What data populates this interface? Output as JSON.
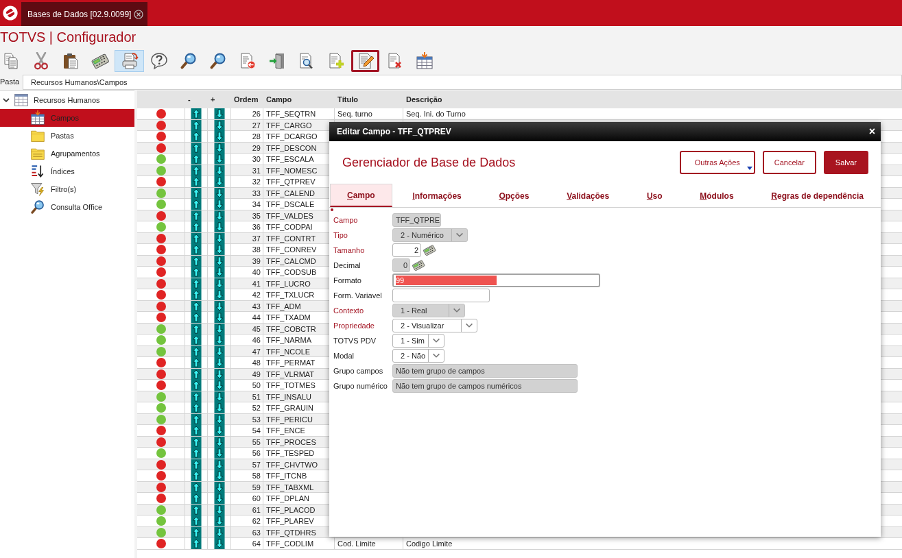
{
  "top_bar": {
    "tab": {
      "label": "Bases de Dados [02.9.0099]"
    }
  },
  "app_title": "TOTVS | Configurador",
  "toolbar": [
    {
      "hovered": false,
      "selected": false
    },
    {
      "hovered": false,
      "selected": false
    },
    {
      "hovered": false,
      "selected": false
    },
    {
      "hovered": false,
      "selected": false
    },
    {
      "hovered": true,
      "selected": false
    },
    {
      "hovered": false,
      "selected": false
    },
    {
      "hovered": false,
      "selected": false
    },
    {
      "hovered": false,
      "selected": false
    },
    {
      "hovered": false,
      "selected": false
    },
    {
      "hovered": false,
      "selected": false
    },
    {
      "hovered": false,
      "selected": false
    },
    {
      "hovered": false,
      "selected": false
    },
    {
      "hovered": false,
      "selected": true
    },
    {
      "hovered": false,
      "selected": false
    },
    {
      "hovered": false,
      "selected": false
    }
  ],
  "path": {
    "label": "Pasta",
    "value": "Recursos Humanos\\Campos"
  },
  "tree": [
    {
      "label": "Recursos Humanos",
      "expanded": true,
      "selected": false,
      "children": [
        {
          "label": "Campos",
          "selected": true
        },
        {
          "label": "Pastas",
          "selected": false
        },
        {
          "label": "Agrupamentos",
          "selected": false
        },
        {
          "label": "Índices",
          "selected": false
        },
        {
          "label": "Filtro(s)",
          "selected": false
        },
        {
          "label": "Consulta Office",
          "selected": false
        }
      ]
    }
  ],
  "table": {
    "columns": [
      "-",
      "+",
      "Ordem",
      "Campo",
      "Título",
      "Descrição"
    ],
    "rows": [
      {
        "color": "#e02424",
        "order": "26",
        "field": "TFF_SEQTRN",
        "title": "Seq. turno",
        "description": "Seq. Ini. do Turno"
      },
      {
        "color": "#e02424",
        "order": "27",
        "field": "TFF_CARGO"
      },
      {
        "color": "#e02424",
        "order": "28",
        "field": "TFF_DCARGO"
      },
      {
        "color": "#e02424",
        "order": "29",
        "field": "TFF_DESCON"
      },
      {
        "color": "#74c43e",
        "order": "30",
        "field": "TFF_ESCALA"
      },
      {
        "color": "#74c43e",
        "order": "31",
        "field": "TFF_NOMESC"
      },
      {
        "color": "#e02424",
        "order": "32",
        "field": "TFF_QTPREV"
      },
      {
        "color": "#74c43e",
        "order": "33",
        "field": "TFF_CALEND"
      },
      {
        "color": "#74c43e",
        "order": "34",
        "field": "TFF_DSCALE"
      },
      {
        "color": "#e02424",
        "order": "35",
        "field": "TFF_VALDES"
      },
      {
        "color": "#74c43e",
        "order": "36",
        "field": "TFF_CODPAI"
      },
      {
        "color": "#e02424",
        "order": "37",
        "field": "TFF_CONTRT"
      },
      {
        "color": "#e02424",
        "order": "38",
        "field": "TFF_CONREV"
      },
      {
        "color": "#e02424",
        "order": "39",
        "field": "TFF_CALCMD"
      },
      {
        "color": "#e02424",
        "order": "40",
        "field": "TFF_CODSUB"
      },
      {
        "color": "#e02424",
        "order": "41",
        "field": "TFF_LUCRO"
      },
      {
        "color": "#e02424",
        "order": "42",
        "field": "TFF_TXLUCR"
      },
      {
        "color": "#e02424",
        "order": "43",
        "field": "TFF_ADM"
      },
      {
        "color": "#e02424",
        "order": "44",
        "field": "TFF_TXADM"
      },
      {
        "color": "#74c43e",
        "order": "45",
        "field": "TFF_COBCTR"
      },
      {
        "color": "#74c43e",
        "order": "46",
        "field": "TFF_NARMA"
      },
      {
        "color": "#74c43e",
        "order": "47",
        "field": "TFF_NCOLE"
      },
      {
        "color": "#e02424",
        "order": "48",
        "field": "TFF_PERMAT"
      },
      {
        "color": "#e02424",
        "order": "49",
        "field": "TFF_VLRMAT"
      },
      {
        "color": "#e02424",
        "order": "50",
        "field": "TFF_TOTMES"
      },
      {
        "color": "#74c43e",
        "order": "51",
        "field": "TFF_INSALU"
      },
      {
        "color": "#74c43e",
        "order": "52",
        "field": "TFF_GRAUIN"
      },
      {
        "color": "#74c43e",
        "order": "53",
        "field": "TFF_PERICU"
      },
      {
        "color": "#e02424",
        "order": "54",
        "field": "TFF_ENCE"
      },
      {
        "color": "#e02424",
        "order": "55",
        "field": "TFF_PROCES"
      },
      {
        "color": "#74c43e",
        "order": "56",
        "field": "TFF_TESPED"
      },
      {
        "color": "#e02424",
        "order": "57",
        "field": "TFF_CHVTWO"
      },
      {
        "color": "#e02424",
        "order": "58",
        "field": "TFF_ITCNB"
      },
      {
        "color": "#e02424",
        "order": "59",
        "field": "TFF_TABXML"
      },
      {
        "color": "#e02424",
        "order": "60",
        "field": "TFF_DPLAN"
      },
      {
        "color": "#74c43e",
        "order": "61",
        "field": "TFF_PLACOD"
      },
      {
        "color": "#74c43e",
        "order": "62",
        "field": "TFF_PLAREV"
      },
      {
        "color": "#74c43e",
        "order": "63",
        "field": "TFF_QTDHRS"
      },
      {
        "color": "#e02424",
        "order": "64",
        "field": "TFF_CODLIM",
        "title": "Cod. Limite",
        "description": "Codigo Limite"
      }
    ]
  },
  "dialog": {
    "title": "Editar Campo - TFF_QTPREV",
    "close": "×",
    "heading": "Gerenciador de Base de Dados",
    "buttons": [
      {
        "label": "Outras Ações",
        "kind": "menu"
      },
      {
        "label": "Cancelar",
        "kind": "secondary"
      },
      {
        "label": "Salvar",
        "kind": "primary"
      }
    ],
    "tabs": [
      {
        "label": "Campo",
        "selected": true
      },
      {
        "label": "Informações",
        "selected": false
      },
      {
        "label": "Opções",
        "selected": false
      },
      {
        "label": "Validações",
        "selected": false
      },
      {
        "label": "Uso",
        "selected": false
      },
      {
        "label": "Módulos",
        "selected": false
      },
      {
        "label": "Regras de dependência",
        "selected": false
      }
    ],
    "fields": [
      {
        "label": "Campo",
        "required": true,
        "kind": "text",
        "disabled": true,
        "value": "TFF_QTPRE",
        "text_selected": false
      },
      {
        "label": "Tipo",
        "required": true,
        "kind": "select",
        "disabled": true,
        "value": "2 - Numérico",
        "text_selected": false
      },
      {
        "label": "Tamanho",
        "required": true,
        "kind": "number",
        "disabled": false,
        "value": "2",
        "text_selected": false
      },
      {
        "label": "Decimal",
        "required": false,
        "kind": "number",
        "disabled": true,
        "value": "0",
        "text_selected": false
      },
      {
        "label": "Formato",
        "required": false,
        "kind": "text",
        "disabled": false,
        "value": "99",
        "text_selected": true
      },
      {
        "label": "Form. Variavel",
        "required": false,
        "kind": "text",
        "disabled": false,
        "text_selected": false
      },
      {
        "label": "Contexto",
        "required": true,
        "kind": "select",
        "disabled": true,
        "value": "1 - Real",
        "text_selected": false
      },
      {
        "label": "Propriedade",
        "required": true,
        "kind": "select",
        "disabled": false,
        "value": "2 - Visualizar",
        "text_selected": false
      },
      {
        "label": "TOTVS PDV",
        "required": false,
        "kind": "select",
        "disabled": false,
        "value": "1 - Sim",
        "text_selected": false
      },
      {
        "label": "Modal",
        "required": false,
        "kind": "select",
        "disabled": false,
        "value": "2 - Não",
        "text_selected": false
      },
      {
        "label": "Grupo campos",
        "required": false,
        "kind": "text",
        "disabled": true,
        "value": "Não tem grupo de campos",
        "text_selected": false
      },
      {
        "label": "Grupo numérico",
        "required": false,
        "kind": "text",
        "disabled": true,
        "value": "Não tem grupo de campos numéricos",
        "text_selected": false
      }
    ]
  }
}
